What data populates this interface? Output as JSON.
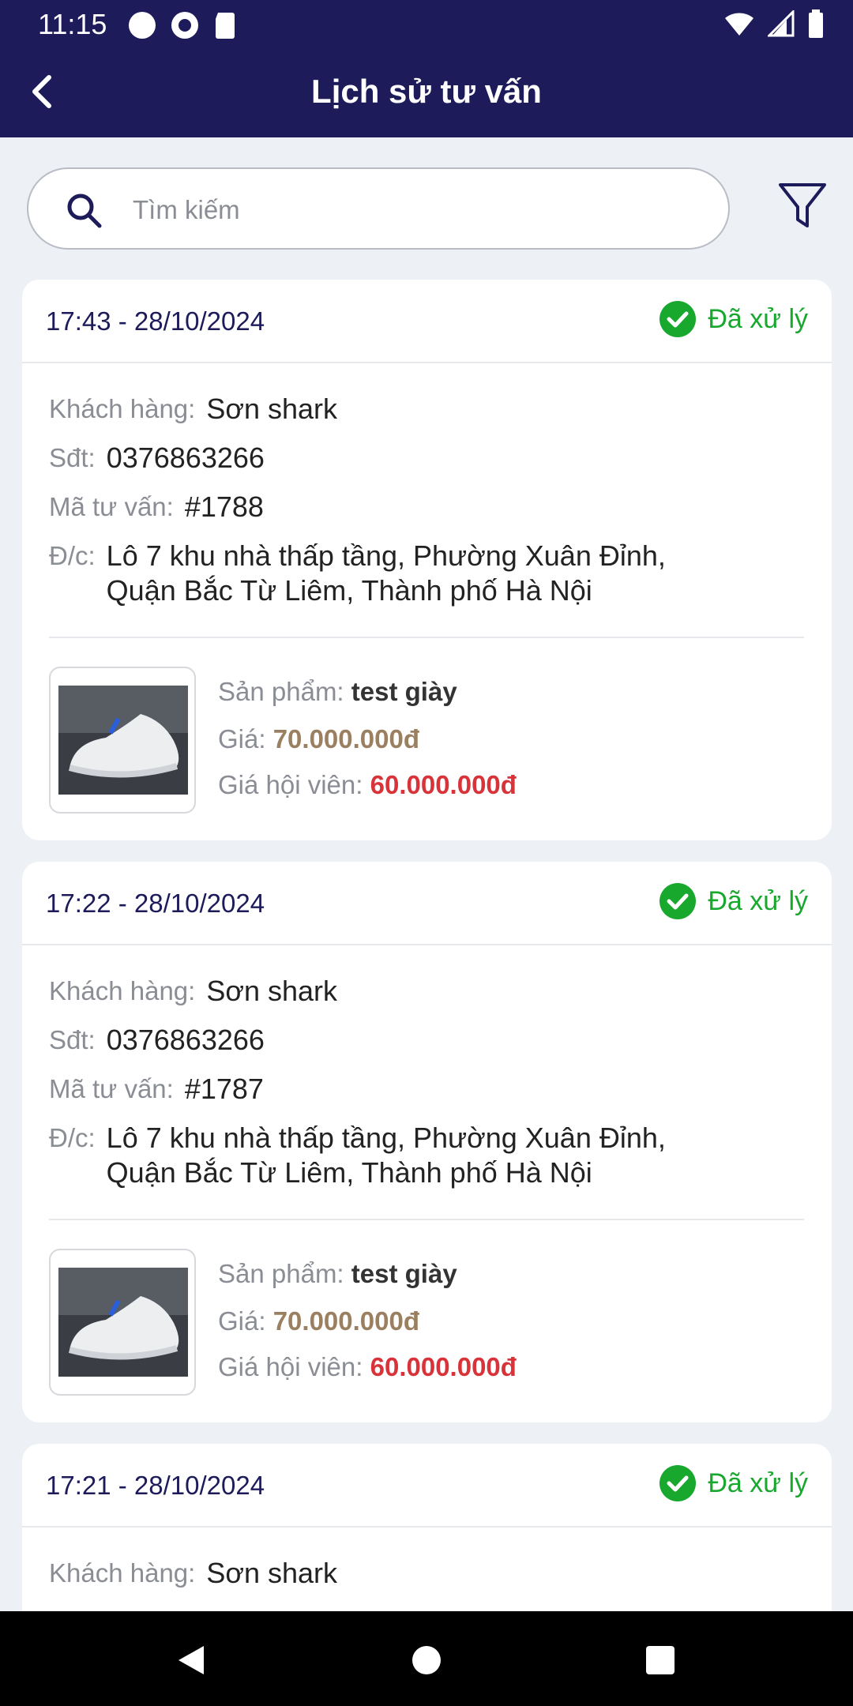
{
  "status_bar": {
    "time": "11:15"
  },
  "header": {
    "title": "Lịch sử tư vấn"
  },
  "search": {
    "placeholder": "Tìm kiếm"
  },
  "labels": {
    "customer": "Khách hàng:",
    "phone": "Sđt:",
    "code": "Mã tư vấn:",
    "address": "Đ/c:",
    "product": "Sản phẩm:",
    "price": "Giá:",
    "member_price": "Giá hội viên:"
  },
  "colors": {
    "header_bg": "#1d1b5a",
    "status_green": "#18a82e",
    "price_gold": "#9a8060",
    "member_price_red": "#d9333a"
  },
  "orders": [
    {
      "datetime": "17:43 - 28/10/2024",
      "status": "Đã xử lý",
      "customer": "Sơn shark",
      "phone": "0376863266",
      "code": "#1788",
      "address_line1": "Lô 7 khu nhà thấp tầng, Phường Xuân Đỉnh,",
      "address_line2": "Quận Bắc Từ Liêm, Thành phố Hà Nội",
      "product_name": "test giày",
      "price": "70.000.000đ",
      "member_price": "60.000.000đ"
    },
    {
      "datetime": "17:22 - 28/10/2024",
      "status": "Đã xử lý",
      "customer": "Sơn shark",
      "phone": "0376863266",
      "code": "#1787",
      "address_line1": "Lô 7 khu nhà thấp tầng, Phường Xuân Đỉnh,",
      "address_line2": "Quận Bắc Từ Liêm, Thành phố Hà Nội",
      "product_name": "test giày",
      "price": "70.000.000đ",
      "member_price": "60.000.000đ"
    },
    {
      "datetime": "17:21 - 28/10/2024",
      "status": "Đã xử lý",
      "customer": "Sơn shark"
    }
  ],
  "icons": {
    "back": "chevron-left-icon",
    "search": "search-icon",
    "filter": "filter-icon",
    "status": "check-circle-icon",
    "nav_back": "triangle-back-icon",
    "nav_home": "circle-home-icon",
    "nav_recent": "square-recents-icon"
  }
}
